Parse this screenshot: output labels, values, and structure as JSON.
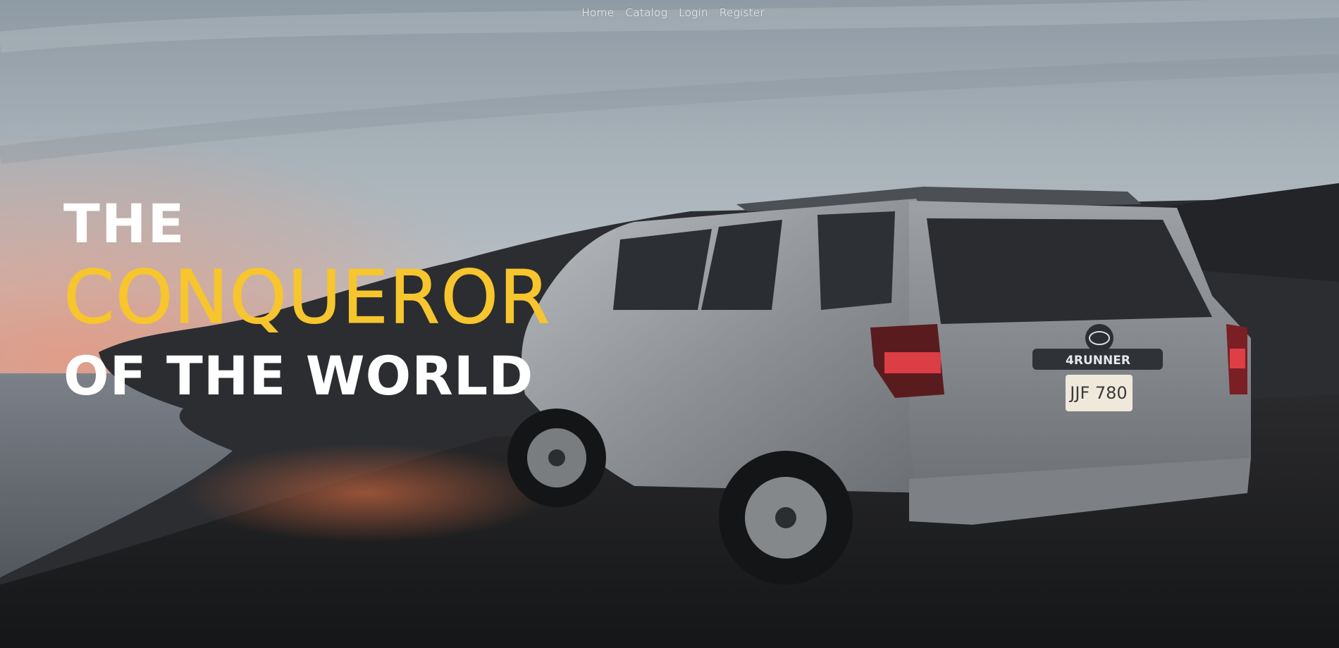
{
  "nav": {
    "items": [
      {
        "label": "Home"
      },
      {
        "label": "Catalog"
      },
      {
        "label": "Login"
      },
      {
        "label": "Register"
      }
    ]
  },
  "hero": {
    "line1": "THE",
    "line2": "CONQUEROR",
    "line3": "OF THE WORLD",
    "plate": "JJF 780",
    "badge": "4RUNNER",
    "accent_color": "#f7c52d"
  }
}
